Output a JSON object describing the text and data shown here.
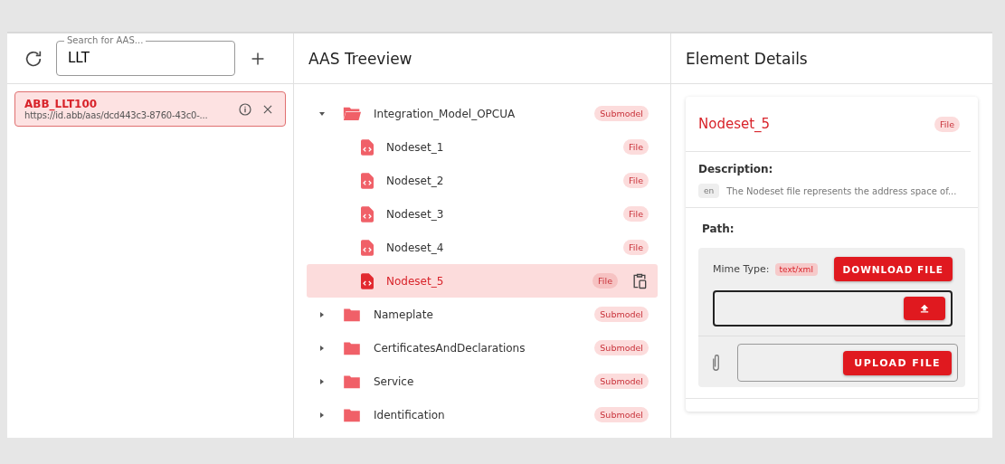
{
  "aas_list": {
    "search": {
      "label": "Search for AAS...",
      "value": "LLT"
    },
    "items": [
      {
        "name": "ABB_LLT100",
        "id": "https://id.abb/aas/dcd443c3-8760-43c0-...",
        "selected": true
      }
    ]
  },
  "treeview": {
    "title": "AAS Treeview",
    "items": [
      {
        "kind": "submodel",
        "name": "Integration_Model_OPCUA",
        "type": "Submodel",
        "expanded": true,
        "selected": false,
        "children": [
          {
            "kind": "file",
            "name": "Nodeset_1",
            "type": "File",
            "selected": false
          },
          {
            "kind": "file",
            "name": "Nodeset_2",
            "type": "File",
            "selected": false
          },
          {
            "kind": "file",
            "name": "Nodeset_3",
            "type": "File",
            "selected": false
          },
          {
            "kind": "file",
            "name": "Nodeset_4",
            "type": "File",
            "selected": false
          },
          {
            "kind": "file",
            "name": "Nodeset_5",
            "type": "File",
            "selected": true
          }
        ]
      },
      {
        "kind": "submodel",
        "name": "Nameplate",
        "type": "Submodel",
        "expanded": false,
        "selected": false
      },
      {
        "kind": "submodel",
        "name": "CertificatesAndDeclarations",
        "type": "Submodel",
        "expanded": false,
        "selected": false
      },
      {
        "kind": "submodel",
        "name": "Service",
        "type": "Submodel",
        "expanded": false,
        "selected": false
      },
      {
        "kind": "submodel",
        "name": "Identification",
        "type": "Submodel",
        "expanded": false,
        "selected": false
      }
    ]
  },
  "details": {
    "title": "Element Details",
    "name": "Nodeset_5",
    "type": "File",
    "description_label": "Description:",
    "description": {
      "lang": "en",
      "text": "The Nodeset file represents the address space of..."
    },
    "path_label": "Path:",
    "mime_label": "Mime Type:",
    "mime_value": "text/xml",
    "download_button": "DOWNLOAD FILE",
    "upload_button": "UPLOAD FILE"
  }
}
